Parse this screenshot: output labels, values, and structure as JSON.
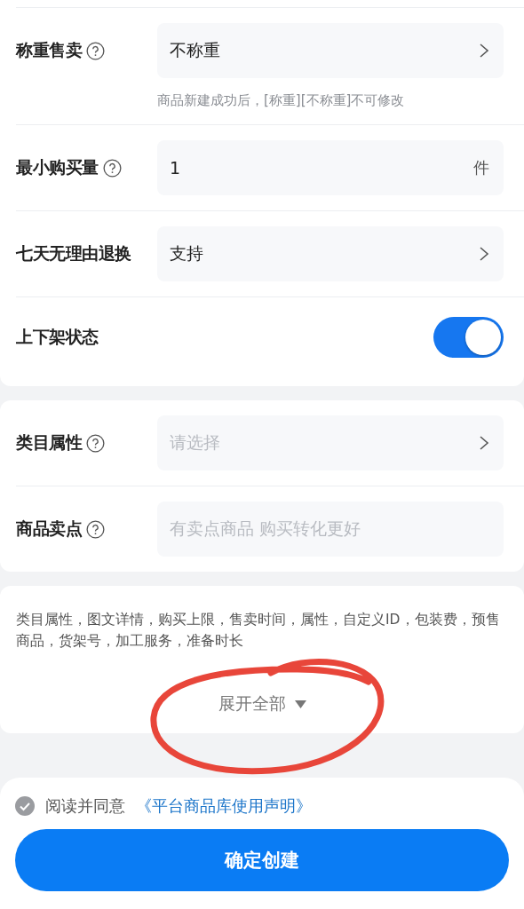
{
  "cards": [
    {
      "rows": [
        {
          "kind": "select",
          "label": "称重售卖",
          "help": true,
          "value": "不称重",
          "hint": "商品新建成功后，[称重][不称重]不可修改"
        },
        {
          "kind": "input",
          "label": "最小购买量",
          "help": true,
          "value": "1",
          "unit": "件"
        },
        {
          "kind": "select",
          "label": "七天无理由退换",
          "help": false,
          "value": "支持"
        },
        {
          "kind": "toggle",
          "label": "上下架状态",
          "help": false,
          "on": true
        }
      ]
    },
    {
      "rows": [
        {
          "kind": "select",
          "label": "类目属性",
          "help": true,
          "placeholder": "请选择"
        },
        {
          "kind": "input",
          "label": "商品卖点",
          "help": true,
          "placeholder": "有卖点商品 购买转化更好"
        }
      ]
    }
  ],
  "more": {
    "summary": "类目属性，图文详情，购买上限，售卖时间，属性，自定义ID，包装费，预售商品，货架号，加工服务，准备时长",
    "expand": "展开全部",
    "annotation": {
      "kind": "circle"
    }
  },
  "footer": {
    "agree": {
      "checked": false,
      "text": "阅读并同意",
      "link": "《平台商品库使用声明》"
    },
    "button": "确定创建"
  }
}
